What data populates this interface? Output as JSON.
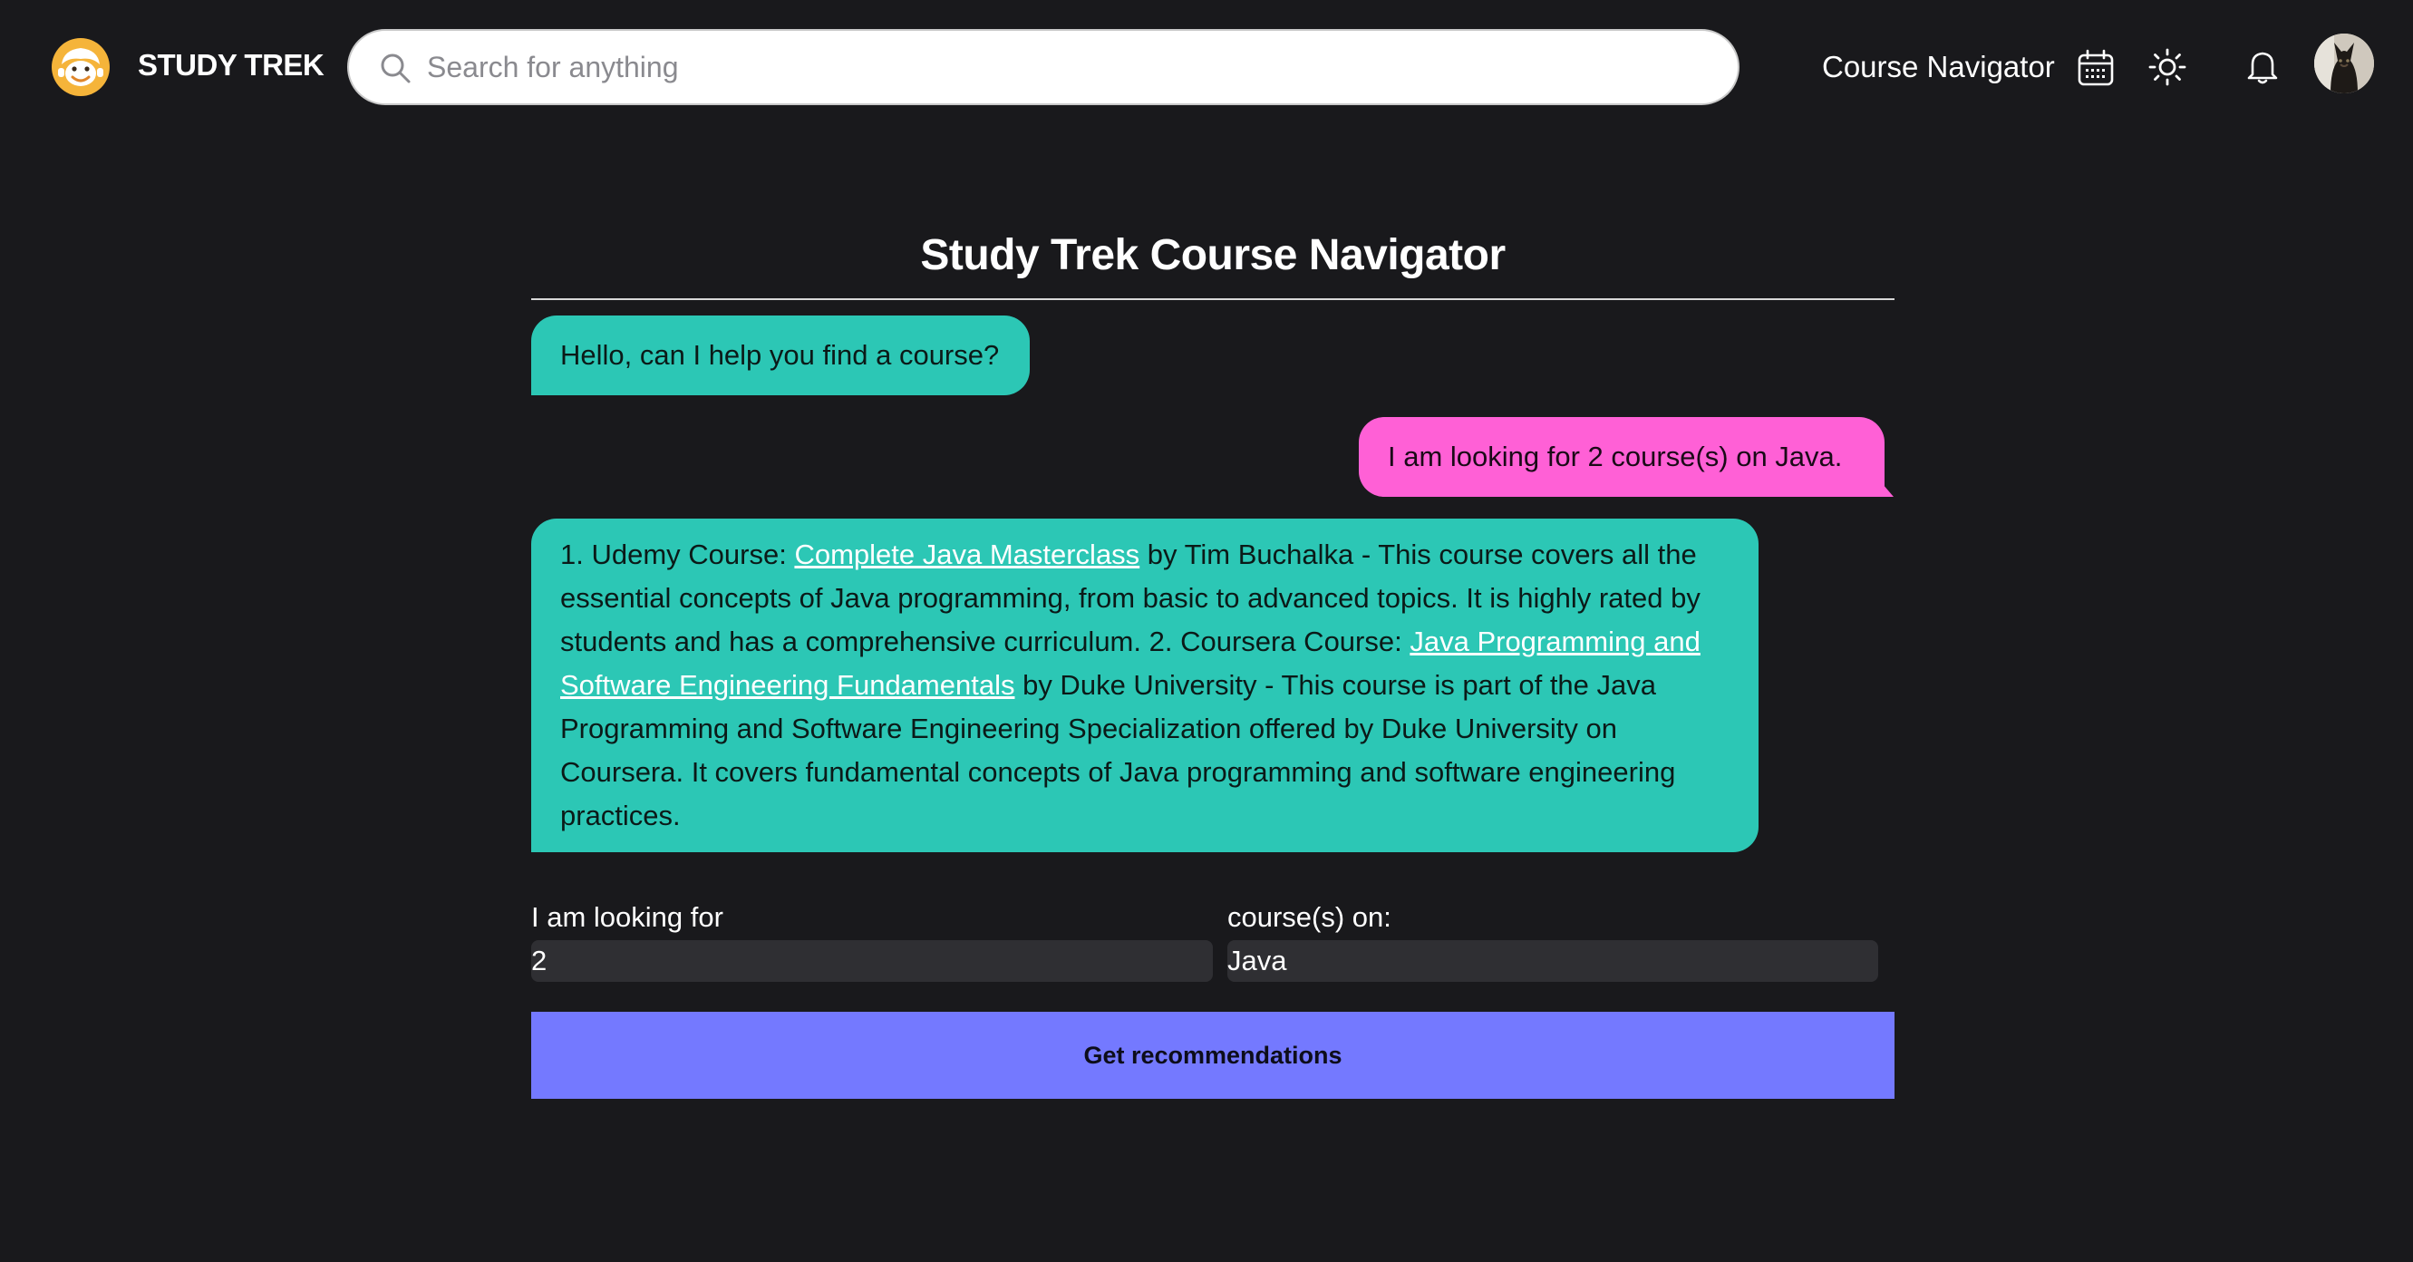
{
  "header": {
    "brand": "STUDY TREK",
    "search_placeholder": "Search for anything",
    "search_value": "",
    "nav_link": "Course Navigator",
    "icons": [
      "calendar-icon",
      "sun-icon",
      "bell-icon"
    ]
  },
  "main": {
    "title": "Study Trek Course Navigator",
    "messages": [
      {
        "role": "bot",
        "text": "Hello, can I help you find a course?"
      },
      {
        "role": "user",
        "text": "I am looking for 2 course(s) on Java."
      },
      {
        "role": "bot",
        "p1": "1. Udemy Course: ",
        "link1": "Complete Java Masterclass",
        "p2": " by Tim Buchalka - This course covers all the essential concepts of Java programming, from basic to advanced topics. It is highly rated by students and has a comprehensive curriculum. 2. Coursera Course: ",
        "link2": "Java Programming and Software Engineering Fundamentals",
        "p3": " by Duke University - This course is part of the Java Programming and Software Engineering Specialization offered by Duke University on Coursera. It covers fundamental concepts of Java programming and software engineering practices."
      }
    ],
    "form": {
      "count_label": "I am looking for",
      "count_value": "2",
      "topic_label": "course(s) on:",
      "topic_value": "Java",
      "submit_label": "Get recommendations"
    }
  },
  "colors": {
    "background": "#19191c",
    "bot_bubble": "#2cc7b5",
    "user_bubble": "#ff60d6",
    "button": "#7479ff",
    "field": "#2f2f33"
  }
}
